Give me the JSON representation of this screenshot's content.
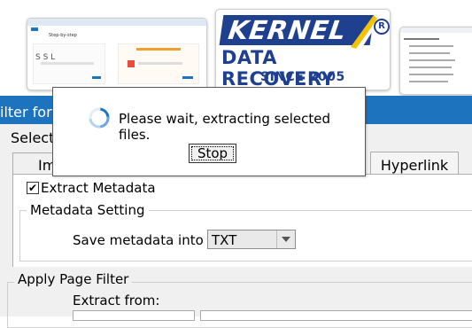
{
  "thumbnails": {
    "thumb1": {
      "heading": "Step-by-step"
    },
    "thumb2": {
      "logo_main": "KERNEL",
      "logo_reg": "R",
      "logo_line2": "DATA RECOVERY",
      "logo_line3": "SINCE 2005"
    }
  },
  "background_dialog": {
    "title": "ilter for E",
    "select_label": "Select i",
    "tabs": [
      {
        "label": "Im"
      },
      {
        "label": "Hyperlink"
      }
    ],
    "extract_metadata": {
      "label": "Extract Metadata",
      "checked": "✔"
    },
    "metadata_setting": {
      "legend": "Metadata Setting",
      "save_label": "Save metadata into :",
      "save_value": "TXT"
    },
    "page_filter": {
      "legend": "Apply Page Filter",
      "extract_from_label": "Extract from:"
    }
  },
  "modal": {
    "message": "Please wait, extracting selected files.",
    "stop_label": "Stop"
  },
  "colors": {
    "titlebar": "#1e73be",
    "logo_blue": "#1f3f8f",
    "logo_yellow": "#f3c300"
  }
}
